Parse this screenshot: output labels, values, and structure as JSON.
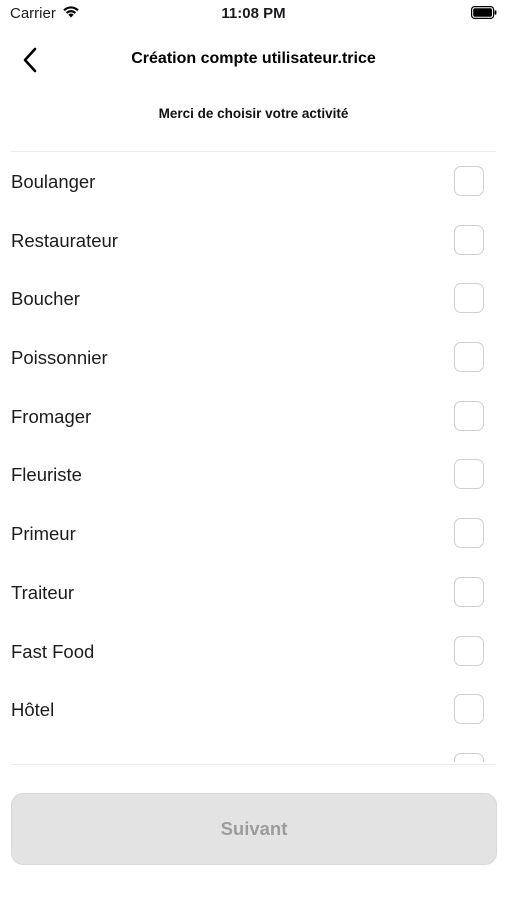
{
  "status_bar": {
    "carrier": "Carrier",
    "time": "11:08 PM",
    "wifi_icon": "wifi-icon",
    "battery_icon": "battery-full-icon"
  },
  "nav": {
    "back_icon": "chevron-left-icon",
    "title": "Création compte utilisateur.trice"
  },
  "subtitle": "Merci de choisir votre activité",
  "activities": [
    {
      "label": "Boulanger",
      "checked": false
    },
    {
      "label": "Restaurateur",
      "checked": false
    },
    {
      "label": "Boucher",
      "checked": false
    },
    {
      "label": "Poissonnier",
      "checked": false
    },
    {
      "label": "Fromager",
      "checked": false
    },
    {
      "label": "Fleuriste",
      "checked": false
    },
    {
      "label": "Primeur",
      "checked": false
    },
    {
      "label": "Traiteur",
      "checked": false
    },
    {
      "label": "Fast Food",
      "checked": false
    },
    {
      "label": "Hôtel",
      "checked": false
    },
    {
      "label": "",
      "checked": false
    }
  ],
  "next_button": {
    "label": "Suivant",
    "enabled": false
  },
  "colors": {
    "button_bg_disabled": "#e3e3e3",
    "button_text_disabled": "#9c9c9c",
    "checkbox_border": "#cfcfd4",
    "divider": "#ececec"
  }
}
